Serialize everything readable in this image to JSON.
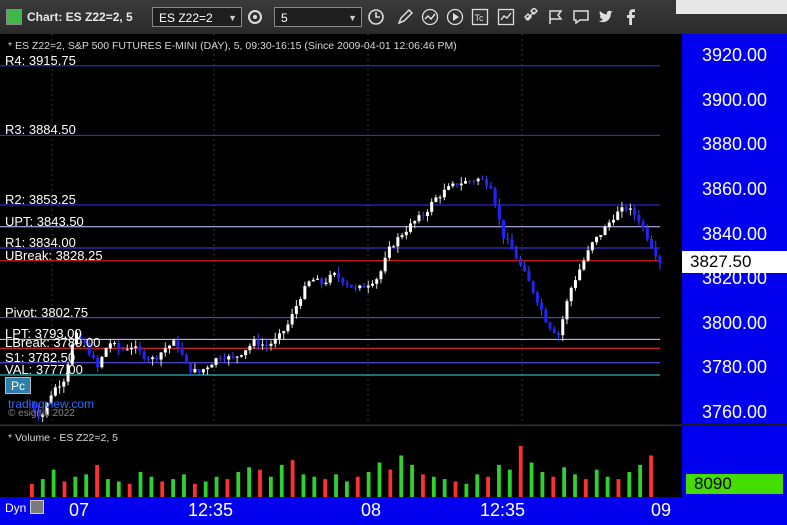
{
  "window": {
    "title": "Chart: ES Z22=2, 5"
  },
  "toolbar": {
    "symbol_value": "ES Z22=2",
    "interval_value": "5",
    "icons": [
      "settings-icon",
      "clock-icon",
      "pencil-icon",
      "trend-icon",
      "play-icon",
      "text-icon",
      "chart-icon",
      "link-icon",
      "comment-icon",
      "twitter-icon",
      "facebook-icon"
    ]
  },
  "chart_header": "* ES Z22=2, S&P 500 FUTURES E-MINI (DAY), 5, 09:30-16:15 (Since 2009-04-01 12:06:46 PM)",
  "volume_header": "* Volume - ES Z22=2, 5",
  "pc_badge": "Pc",
  "levels": [
    {
      "label": "R4: 3915.75",
      "price": 3915.75,
      "color": "#3030ff",
      "style": "solid"
    },
    {
      "label": "R3: 3884.50",
      "price": 3884.5,
      "color": "#3030ff",
      "style": "solid"
    },
    {
      "label": "R2: 3853.25",
      "price": 3853.25,
      "color": "#3030ff",
      "style": "solid"
    },
    {
      "label": "UPT: 3843.50",
      "price": 3843.5,
      "color": "#c8c8ff",
      "style": "solid"
    },
    {
      "label": "R1: 3834.00",
      "price": 3834.0,
      "color": "#4040ff",
      "style": "solid"
    },
    {
      "label": "UBreak: 3828.25",
      "price": 3828.25,
      "color": "#ff2020",
      "style": "solid"
    },
    {
      "label": "Pivot: 3802.75",
      "price": 3802.75,
      "color": "#5050ff",
      "style": "solid"
    },
    {
      "label": "LPT: 3793.00",
      "price": 3793.0,
      "color": "#d0d0ff",
      "style": "solid"
    },
    {
      "label": "LBreak: 3789.00",
      "price": 3789.0,
      "color": "#ff3030",
      "style": "solid"
    },
    {
      "label": "S1: 3782.50",
      "price": 3782.5,
      "color": "#6060ff",
      "style": "solid"
    },
    {
      "label": "VAL: 3777.00",
      "price": 3777.0,
      "color": "#30e0e0",
      "style": "solid"
    }
  ],
  "price_axis": {
    "ticks": [
      "3920.00",
      "3900.00",
      "3880.00",
      "3860.00",
      "3840.00",
      "3820.00",
      "3800.00",
      "3780.00",
      "3760.00"
    ],
    "current": "3827.50",
    "current_color": "#ffffff"
  },
  "volume_axis": {
    "current": "8090",
    "current_color": "#44dd00"
  },
  "time_axis": {
    "dyn_label": "Dyn",
    "labels": [
      "07",
      "12:35",
      "08",
      "12:35",
      "09"
    ]
  },
  "watermark": {
    "line1": "tradingview.com",
    "line2": "© esignal 2022"
  },
  "chart_data": {
    "type": "candlestick",
    "symbol": "ES Z22=2",
    "interval": "5",
    "ylim": [
      3755,
      3930
    ],
    "current_price": 3827.5,
    "current_volume": 8090,
    "close_path": [
      [
        0,
        3764
      ],
      [
        4,
        3758
      ],
      [
        8,
        3770
      ],
      [
        12,
        3775
      ],
      [
        16,
        3795
      ],
      [
        20,
        3790
      ],
      [
        24,
        3780
      ],
      [
        28,
        3792
      ],
      [
        32,
        3788
      ],
      [
        36,
        3790
      ],
      [
        40,
        3786
      ],
      [
        44,
        3784
      ],
      [
        48,
        3789
      ],
      [
        52,
        3792
      ],
      [
        56,
        3780
      ],
      [
        60,
        3778
      ],
      [
        64,
        3782
      ],
      [
        68,
        3786
      ],
      [
        72,
        3784
      ],
      [
        76,
        3788
      ],
      [
        80,
        3792
      ],
      [
        84,
        3790
      ],
      [
        88,
        3793
      ],
      [
        92,
        3800
      ],
      [
        96,
        3812
      ],
      [
        100,
        3820
      ],
      [
        104,
        3818
      ],
      [
        108,
        3822
      ],
      [
        112,
        3819
      ],
      [
        116,
        3815
      ],
      [
        120,
        3818
      ],
      [
        124,
        3821
      ],
      [
        128,
        3834
      ],
      [
        132,
        3840
      ],
      [
        136,
        3845
      ],
      [
        140,
        3849
      ],
      [
        144,
        3856
      ],
      [
        148,
        3860
      ],
      [
        152,
        3863
      ],
      [
        156,
        3864
      ],
      [
        160,
        3865
      ],
      [
        164,
        3862
      ],
      [
        168,
        3840
      ],
      [
        172,
        3832
      ],
      [
        176,
        3822
      ],
      [
        180,
        3812
      ],
      [
        184,
        3800
      ],
      [
        188,
        3795
      ],
      [
        192,
        3815
      ],
      [
        196,
        3826
      ],
      [
        200,
        3836
      ],
      [
        204,
        3842
      ],
      [
        208,
        3849
      ],
      [
        212,
        3852
      ],
      [
        216,
        3848
      ],
      [
        220,
        3838
      ],
      [
        224,
        3828
      ]
    ],
    "volume_profile": [
      6,
      8,
      12,
      7,
      9,
      10,
      14,
      8,
      7,
      6,
      11,
      9,
      7,
      8,
      10,
      6,
      7,
      9,
      8,
      11,
      13,
      12,
      9,
      14,
      16,
      10,
      9,
      8,
      10,
      7,
      9,
      11,
      15,
      12,
      18,
      14,
      10,
      9,
      8,
      7,
      6,
      10,
      9,
      14,
      12,
      22,
      15,
      11,
      9,
      13,
      10,
      8,
      12,
      9,
      8,
      11,
      14,
      18
    ]
  }
}
